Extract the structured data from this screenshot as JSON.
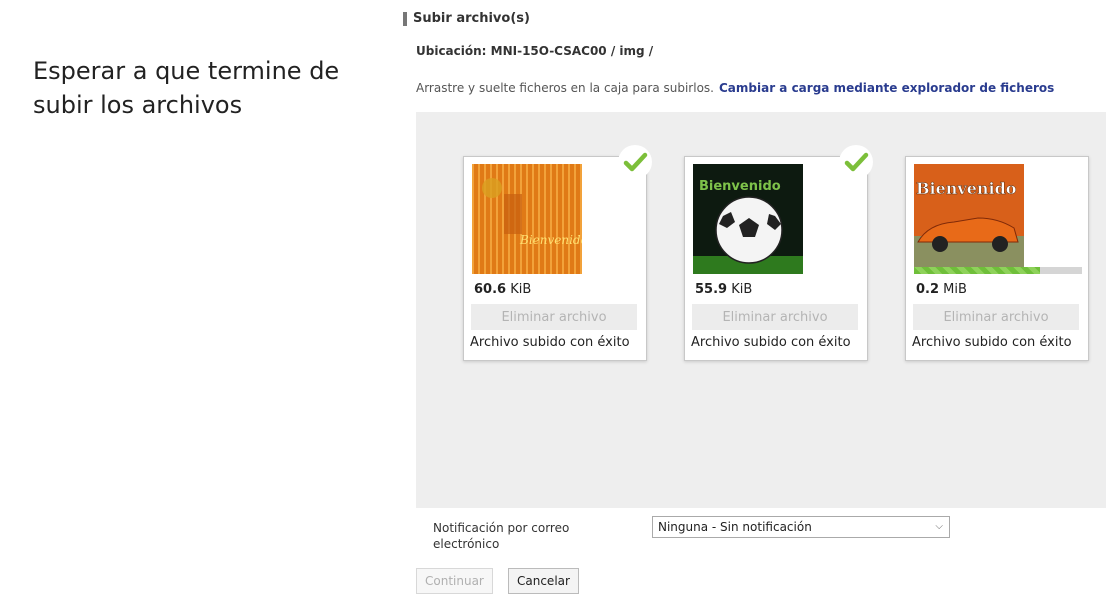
{
  "instruction_text": "Esperar a que termine de subir los archivos",
  "panel": {
    "title": "Subir archivo(s)",
    "location": "Ubicación: MNI-15O-CSAC00 / img /",
    "hint": "Arrastre y suelte ficheros en la caja para subirlos.",
    "hint_link": "Cambiar a carga mediante explorador de ficheros"
  },
  "files": [
    {
      "size_value": "60.6",
      "size_unit": "KiB",
      "remove_label": "Eliminar archivo",
      "status": "Archivo subido con éxito",
      "complete": true,
      "thumb_text": "Bienvenido"
    },
    {
      "size_value": "55.9",
      "size_unit": "KiB",
      "remove_label": "Eliminar archivo",
      "status": "Archivo subido con éxito",
      "complete": true,
      "thumb_text": "Bienvenido"
    },
    {
      "size_value": "0.2",
      "size_unit": "MiB",
      "remove_label": "Eliminar archivo",
      "status": "Archivo subido con éxito",
      "complete": false,
      "progress": 0.75,
      "thumb_text": "Bienvenido"
    }
  ],
  "notification": {
    "label": "Notificación por correo electrónico",
    "selected": "Ninguna - Sin notificación"
  },
  "buttons": {
    "continue": "Continuar",
    "cancel": "Cancelar"
  },
  "colors": {
    "link": "#2a3c8f",
    "check": "#7cbf3a",
    "dropzone": "#eeeeee"
  }
}
